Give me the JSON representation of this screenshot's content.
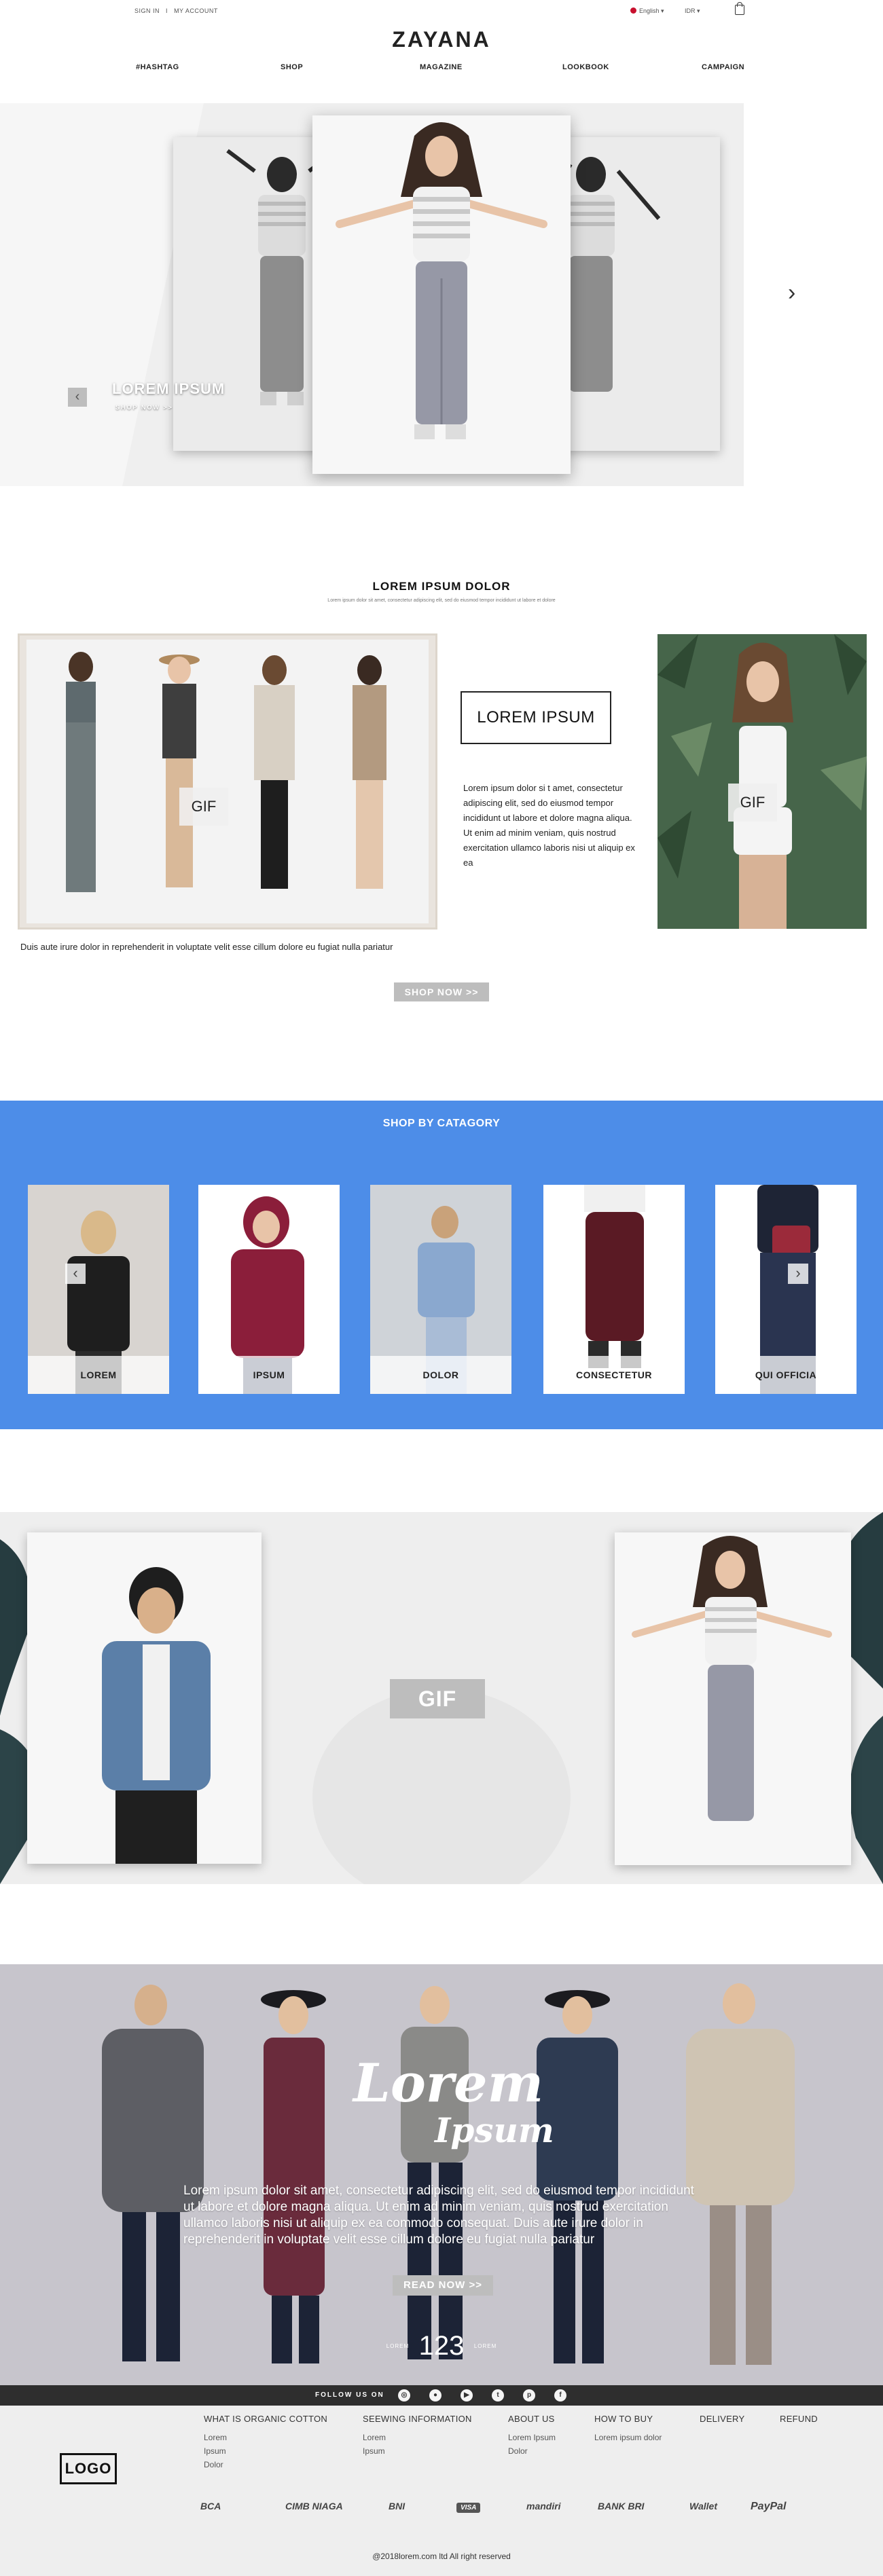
{
  "topbar": {
    "sign_in": "SIGN IN",
    "separator": "I",
    "my_account": "MY ACCOUNT",
    "language": "English",
    "currency": "IDR",
    "chevron": "▾"
  },
  "brand": {
    "name": "ZAYANA"
  },
  "nav": [
    "#HASHTAG",
    "SHOP",
    "MAGAZINE",
    "LOOKBOOK",
    "CAMPAIGN"
  ],
  "hero": {
    "title": "LOREM IPSUM",
    "cta": "SHOP NOW >>",
    "prev_icon": "‹",
    "next_icon": "›"
  },
  "intro": {
    "title": "LOREM IPSUM DOLOR",
    "subtitle": "Lorem ipsum dolor sit amet, consectetur adipiscing elit, sed do eiusmod tempor incididunt ut labore et dolore",
    "gif_left": "GIF",
    "gif_right": "GIF",
    "boxed_title": "LOREM IPSUM",
    "paragraph": "Lorem ipsum dolor si t amet, consectetur adipiscing elit, sed do eiusmod tempor incididunt ut labore et dolore magna aliqua. Ut enim ad minim veniam, quis nostrud exercitation ullamco laboris nisi ut aliquip ex ea",
    "caption": "Duis aute irure dolor in reprehenderit in voluptate velit esse cillum dolore eu fugiat nulla pariatur",
    "button": "SHOP NOW >>"
  },
  "categories": {
    "title": "SHOP BY CATAGORY",
    "items": [
      {
        "label": "LOREM",
        "color": "#1e1e1e"
      },
      {
        "label": "IPSUM",
        "color": "#8b1e3a"
      },
      {
        "label": "DOLOR",
        "color": "#8aa8cf"
      },
      {
        "label": "CONSECTETUR",
        "color": "#5a1a24"
      },
      {
        "label": "QUI OFFICIA",
        "color": "#2a3450"
      }
    ],
    "prev_icon": "‹",
    "next_icon": "›"
  },
  "gif_banner": {
    "label": "GIF"
  },
  "lookbook": {
    "script_1": "Lorem",
    "script_2": "Ipsum",
    "paragraph": "Lorem ipsum dolor sit amet, consectetur adipiscing elit, sed do eiusmod tempor incididunt ut labore et dolore magna aliqua. Ut enim ad minim veniam, quis nostrud exercitation ullamco laboris nisi ut aliquip ex ea commodo consequat. Duis aute irure dolor in reprehenderit in voluptate velit esse cillum dolore eu fugiat nulla pariatur",
    "button": "READ NOW >>",
    "counter_left": "LOREM",
    "counter_value": "123",
    "counter_right": "LOREM"
  },
  "footer": {
    "follow_label": "FOLLOW US ON",
    "social_icons": [
      "instagram-icon",
      "line-icon",
      "youtube-icon",
      "twitter-icon",
      "pinterest-icon",
      "facebook-icon"
    ],
    "logo": "LOGO",
    "columns": [
      {
        "heading": "WHAT IS ORGANIC COTTON",
        "items": [
          "Lorem",
          "Ipsum",
          "Dolor"
        ]
      },
      {
        "heading": "SEEWING INFORMATION",
        "items": [
          "Lorem",
          "Ipsum"
        ]
      },
      {
        "heading": "ABOUT US",
        "items": [
          "Lorem Ipsum",
          "Dolor"
        ]
      },
      {
        "heading": "HOW TO BUY",
        "items": [
          "Lorem ipsum dolor"
        ]
      },
      {
        "heading": "DELIVERY",
        "items": []
      },
      {
        "heading": "REFUND",
        "items": []
      }
    ],
    "payments": [
      "BCA",
      "CIMB NIAGA",
      "BNI",
      "VISA",
      "mandiri",
      "BANK BRI",
      "Wallet",
      "PayPal"
    ],
    "copyright": "@2018lorem.com ltd All right reserved"
  },
  "colors": {
    "accent_blue": "#4d8de8",
    "button_gray": "#bdbdbd",
    "footer_bar": "#2e2e2e"
  }
}
